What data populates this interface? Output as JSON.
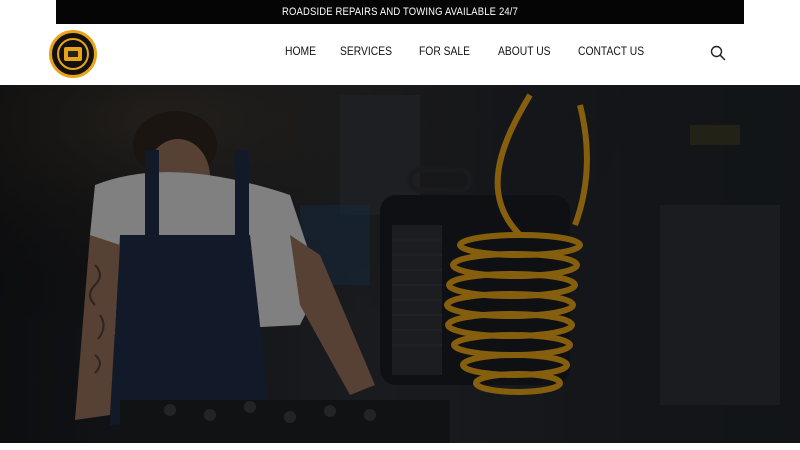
{
  "announcement": {
    "text": "ROADSIDE REPAIRS AND TOWING AVAILABLE 24/7"
  },
  "nav": {
    "items": [
      "HOME",
      "SERVICES",
      "FOR SALE",
      "ABOUT US",
      "CONTACT US"
    ]
  },
  "icons": {
    "search": "search-icon"
  },
  "colors": {
    "topbar_bg": "#050505",
    "header_bg": "#ffffff",
    "logo_accent": "#e8a317",
    "hose_yellow": "#e0a21a"
  }
}
